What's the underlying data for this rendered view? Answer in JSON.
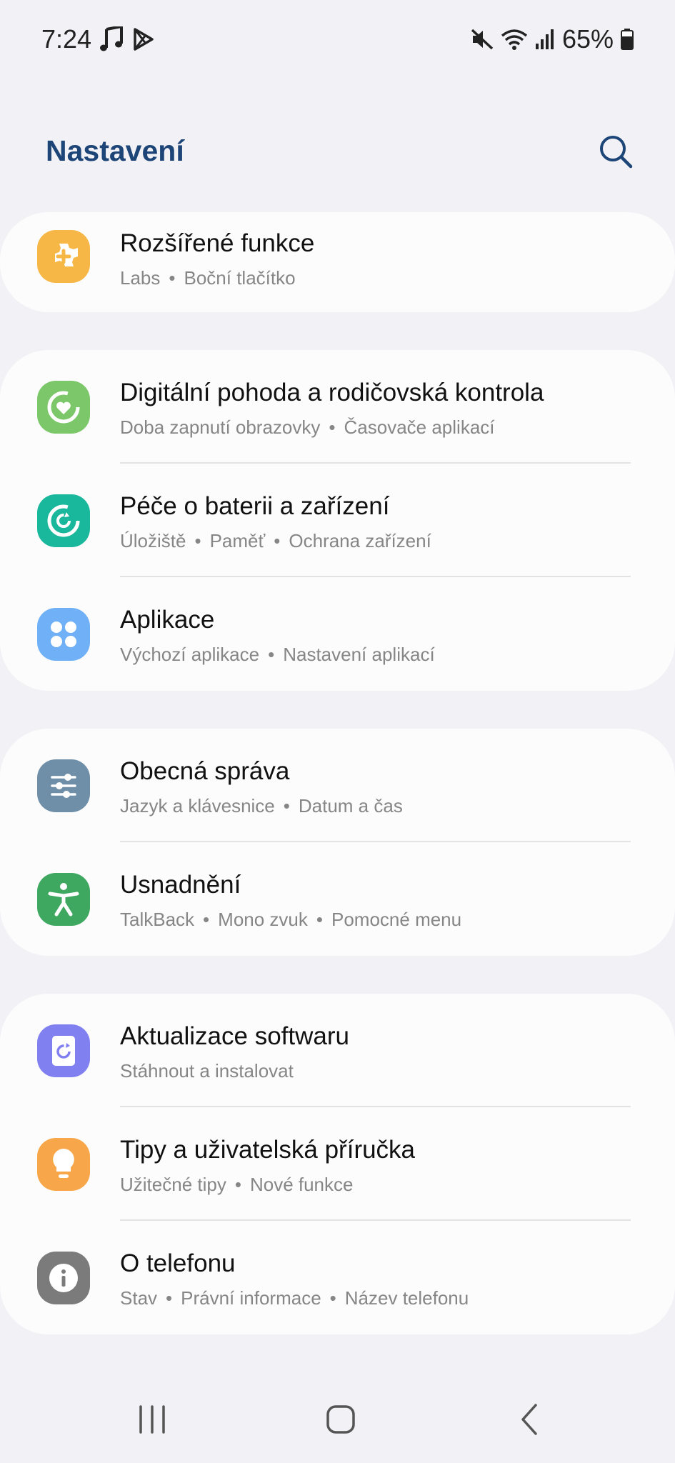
{
  "status": {
    "time": "7:24",
    "battery": "65%",
    "icons": [
      "music-note-icon",
      "play-store-icon",
      "mute-icon",
      "wifi-icon",
      "signal-icon",
      "battery-icon"
    ]
  },
  "header": {
    "title": "Nastavení",
    "search_icon": "search-icon"
  },
  "colors": {
    "title": "#1d4577",
    "advanced": "#f6b746",
    "wellbeing": "#7cc76a",
    "device_care": "#19b79b",
    "apps": "#6fb0f6",
    "general": "#6f8fa8",
    "accessibility": "#3ea760",
    "update": "#8180f0",
    "tips": "#f7a74a",
    "about": "#7b7b7b"
  },
  "groups": [
    {
      "items": [
        {
          "title": "Rozšířené funkce",
          "sub": [
            "Labs",
            "Boční tlačítko"
          ],
          "icon": "puzzle-plus-icon"
        }
      ]
    },
    {
      "items": [
        {
          "title": "Digitální pohoda a rodičovská kontrola",
          "sub": [
            "Doba zapnutí obrazovky",
            "Časovače aplikací"
          ],
          "icon": "heart-circle-icon"
        },
        {
          "title": "Péče o baterii a zařízení",
          "sub": [
            "Úložiště",
            "Paměť",
            "Ochrana zařízení"
          ],
          "icon": "refresh-circle-icon"
        },
        {
          "title": "Aplikace",
          "sub": [
            "Výchozí aplikace",
            "Nastavení aplikací"
          ],
          "icon": "apps-grid-icon"
        }
      ]
    },
    {
      "items": [
        {
          "title": "Obecná správa",
          "sub": [
            "Jazyk a klávesnice",
            "Datum a čas"
          ],
          "icon": "sliders-icon"
        },
        {
          "title": "Usnadnění",
          "sub": [
            "TalkBack",
            "Mono zvuk",
            "Pomocné menu"
          ],
          "icon": "accessibility-person-icon"
        }
      ]
    },
    {
      "items": [
        {
          "title": "Aktualizace softwaru",
          "sub": [
            "Stáhnout a instalovat"
          ],
          "icon": "software-update-icon"
        },
        {
          "title": "Tipy a uživatelská příručka",
          "sub": [
            "Užitečné tipy",
            "Nové funkce"
          ],
          "icon": "lightbulb-icon"
        },
        {
          "title": "O telefonu",
          "sub": [
            "Stav",
            "Právní informace",
            "Název telefonu"
          ],
          "icon": "info-icon"
        }
      ]
    }
  ],
  "navbar": [
    "recent-apps-icon",
    "home-icon",
    "back-icon"
  ]
}
